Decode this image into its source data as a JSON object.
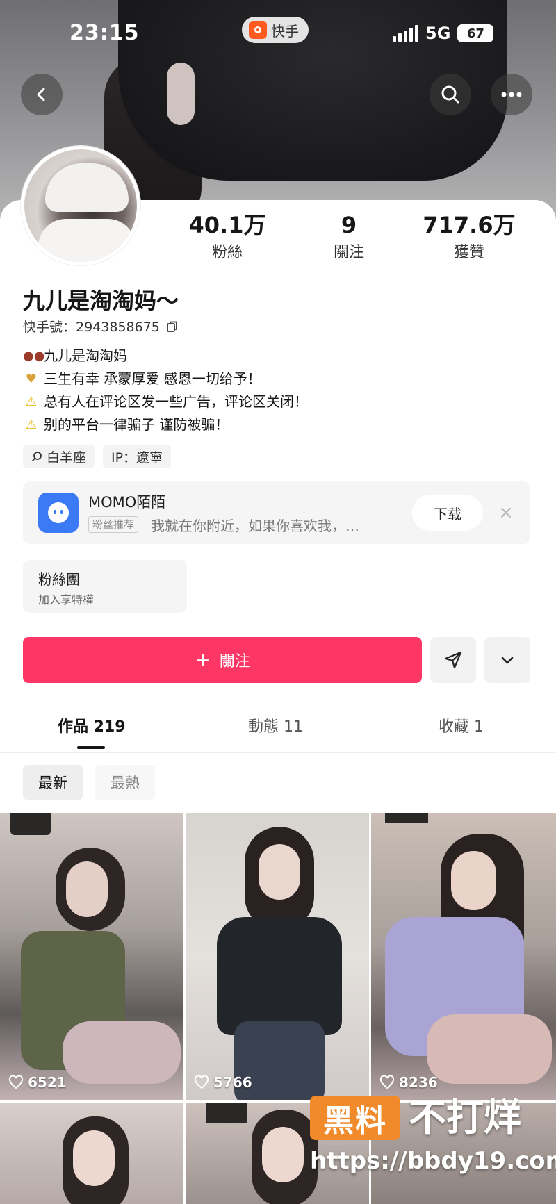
{
  "status_bar": {
    "time": "23:15",
    "app_name": "快手",
    "network": "5G",
    "battery": "67"
  },
  "stats": [
    {
      "value": "40.1万",
      "label": "粉絲"
    },
    {
      "value": "9",
      "label": "關注"
    },
    {
      "value": "717.6万",
      "label": "獲贊"
    }
  ],
  "profile": {
    "nickname": "九儿是淘淘妈～",
    "kuaishou_id": "快手號：2943858675",
    "bio": [
      {
        "icon": "bean-emoji-icon",
        "text": "九儿是淘淘妈"
      },
      {
        "icon": "pray-hands-emoji-icon",
        "text": "三生有幸 承蒙厚爱 感恩一切给予！"
      },
      {
        "icon": "warning-emoji-icon",
        "text": "总有人在评论区发一些广告，评论区关闭！"
      },
      {
        "icon": "warning-emoji-icon",
        "text": "别的平台一律骗子 谨防被骗！"
      }
    ],
    "tags": [
      "白羊座",
      "IP：遼寧"
    ]
  },
  "ad": {
    "name": "MOMO陌陌",
    "tag": "粉丝推荐",
    "description": "我就在你附近，如果你喜欢我，…",
    "button": "下载"
  },
  "fan_club": {
    "title": "粉絲團",
    "subtitle": "加入享特權"
  },
  "actions": {
    "follow": "關注"
  },
  "tabs": [
    {
      "label": "作品 219",
      "active": true
    },
    {
      "label": "動態 11",
      "active": false
    },
    {
      "label": "收藏 1",
      "active": false
    }
  ],
  "sort": {
    "latest": "最新",
    "hot": "最熱"
  },
  "videos": [
    {
      "likes": "6521"
    },
    {
      "likes": "5766"
    },
    {
      "likes": "8236"
    }
  ],
  "watermark": {
    "box": "黑料",
    "text": "不打烊",
    "url": "https://bbdy19.com"
  },
  "colors": {
    "accent": "#fe3666",
    "ad_logo": "#3c79f5",
    "watermark": "#f08a2a"
  }
}
